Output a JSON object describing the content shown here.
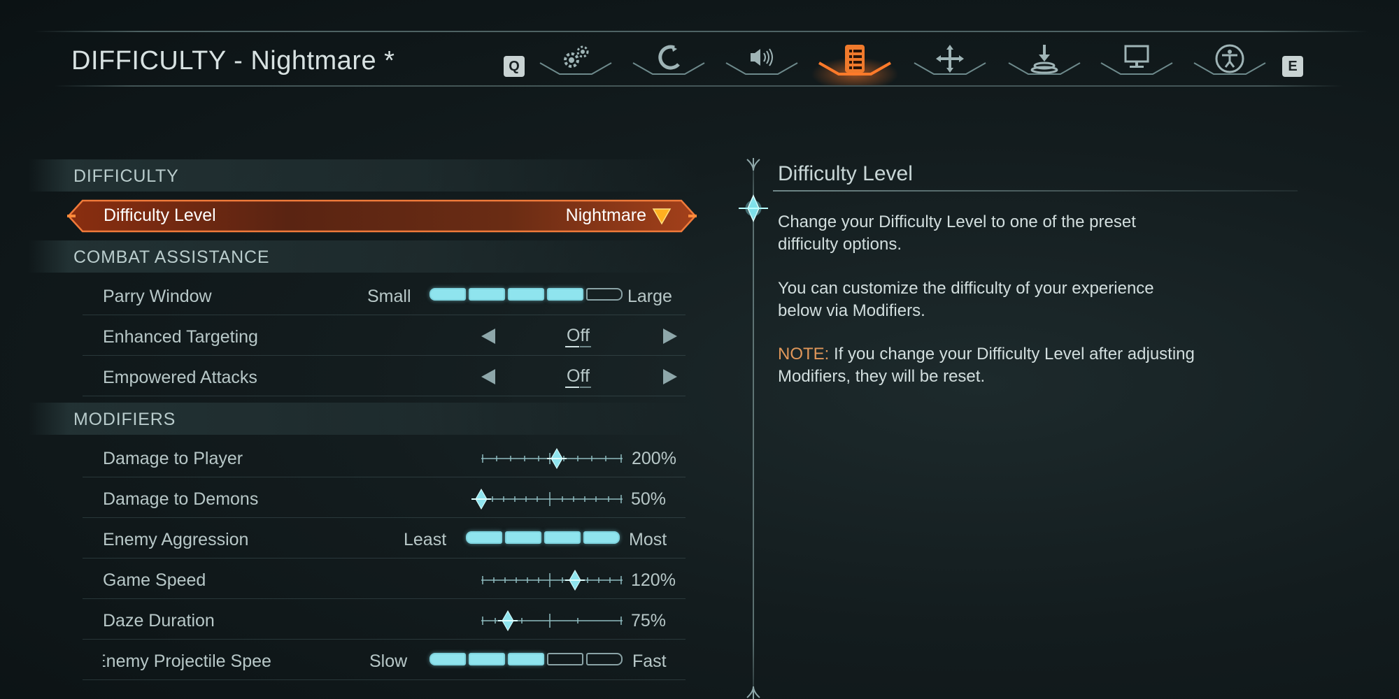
{
  "header": {
    "title": "DIFFICULTY - Nightmare *",
    "left_key": "Q",
    "right_key": "E",
    "tabs": [
      {
        "icon": "gears-icon",
        "active": false
      },
      {
        "icon": "controller-icon",
        "active": false
      },
      {
        "icon": "speaker-icon",
        "active": false
      },
      {
        "icon": "difficulty-list-icon",
        "active": true
      },
      {
        "icon": "crosshair-icon",
        "active": false
      },
      {
        "icon": "download-icon",
        "active": false
      },
      {
        "icon": "monitor-icon",
        "active": false
      },
      {
        "icon": "accessibility-icon",
        "active": false
      }
    ]
  },
  "sections": {
    "difficulty": "DIFFICULTY",
    "combat": "COMBAT ASSISTANCE",
    "modifiers": "MODIFIERS"
  },
  "settings": {
    "difficulty_level": {
      "label": "Difficulty Level",
      "value": "Nightmare"
    },
    "parry_window": {
      "label": "Parry Window",
      "min": "Small",
      "max": "Large",
      "level": 4,
      "steps": 5
    },
    "enhanced_targeting": {
      "label": "Enhanced Targeting",
      "value": "Off"
    },
    "empowered_attacks": {
      "label": "Empowered Attacks",
      "value": "Off"
    },
    "damage_to_player": {
      "label": "Damage to Player",
      "value": "200%"
    },
    "damage_to_demons": {
      "label": "Damage to Demons",
      "value": "50%"
    },
    "enemy_aggression": {
      "label": "Enemy Aggression",
      "min": "Least",
      "max": "Most",
      "level": 4,
      "steps": 4
    },
    "game_speed": {
      "label": "Game Speed",
      "value": "120%"
    },
    "daze_duration": {
      "label": "Daze Duration",
      "value": "75%"
    },
    "enemy_projectile_speed": {
      "label": "Enemy Projectile Spee",
      "min": "Slow",
      "max": "Fast",
      "level": 3,
      "steps": 5
    }
  },
  "description": {
    "title": "Difficulty Level",
    "p1": "Change your Difficulty Level to one of the preset difficulty options.",
    "p2": "You can customize the difficulty of your experience below via Modifiers.",
    "note_label": "NOTE:",
    "note_text": " If you change your Difficulty Level after adjusting Modifiers, they will be reset."
  },
  "colors": {
    "accent_orange": "#e86a24",
    "accent_cyan": "#8fe4ee",
    "note_orange": "#e0975a"
  }
}
